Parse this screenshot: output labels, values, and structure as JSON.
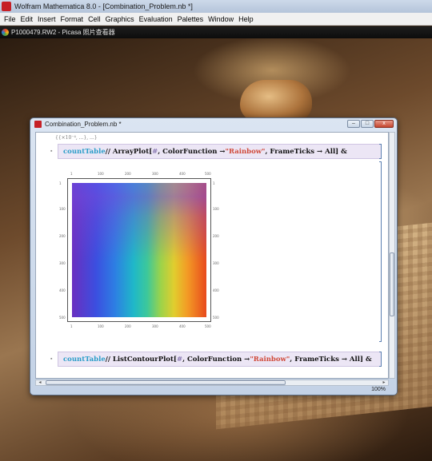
{
  "app": {
    "title": "Wolfram Mathematica 8.0 - [Combination_Problem.nb *]"
  },
  "menu": {
    "items": [
      "File",
      "Edit",
      "Insert",
      "Format",
      "Cell",
      "Graphics",
      "Evaluation",
      "Palettes",
      "Window",
      "Help"
    ]
  },
  "picasa": {
    "title": "P1000479.RW2 - Picasa 照片查看器"
  },
  "notebook": {
    "title": "Combination_Problem.nb *",
    "output_label": "{{×10⁻⁴, ...}, ...}",
    "cell1": {
      "symbol": "countTable",
      "op1": " // ArrayPlot[",
      "slot": "#",
      "op2": ", ColorFunction → ",
      "string": "\"Rainbow\"",
      "op3": ", FrameTicks → All] &"
    },
    "cell2": {
      "symbol": "countTable",
      "op1": " // ListContourPlot[",
      "slot": "#",
      "op2": ", ColorFunction → ",
      "string": "\"Rainbow\"",
      "op3": ", FrameTicks → All] &"
    },
    "plot": {
      "top_ticks": [
        "1",
        "100",
        "200",
        "300",
        "400",
        "500"
      ],
      "bottom_ticks": [
        "1",
        "100",
        "200",
        "300",
        "400",
        "500"
      ],
      "left_ticks": [
        "1",
        "100",
        "200",
        "300",
        "400",
        "500"
      ],
      "right_ticks": [
        "1",
        "100",
        "200",
        "300",
        "400",
        "500"
      ]
    },
    "zoom": "100%"
  },
  "window_controls": {
    "minimize": "–",
    "maximize": "□",
    "close": "x"
  }
}
